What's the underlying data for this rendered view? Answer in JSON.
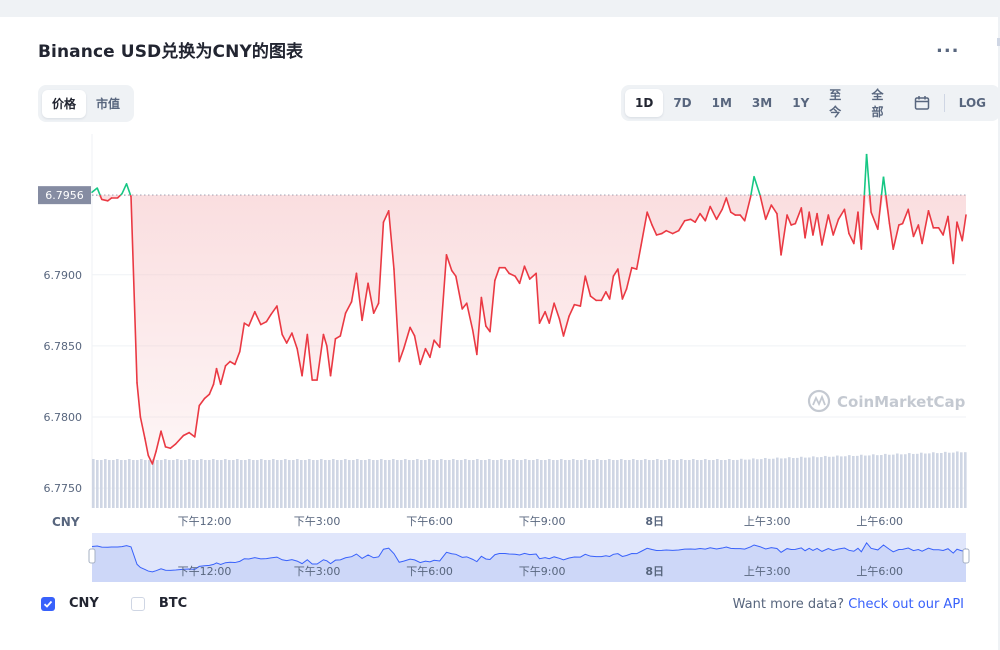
{
  "header": {
    "title": "Binance USD兑换为CNY的图表",
    "more_label": "..."
  },
  "view_toggle": {
    "items": [
      "价格",
      "市值"
    ],
    "active": 0
  },
  "range_toggle": {
    "items": [
      "1D",
      "7D",
      "1M",
      "3M",
      "1Y",
      "至今",
      "全部"
    ],
    "active": 0,
    "calendar_icon": "calendar-icon",
    "log_label": "LOG"
  },
  "watermark": {
    "text": "CoinMarketCap",
    "icon": "coinmarketcap-logo-icon"
  },
  "colors": {
    "up": "#16c784",
    "down": "#ea3943",
    "fill": "#f6c3c6",
    "volume": "#cfd6e4",
    "navigator": "#e0e6fb",
    "navigator_line": "#3861fb",
    "current_label_bg": "#858ca2"
  },
  "chart_data": {
    "type": "line",
    "currency_label": "CNY",
    "current_price_label": "6.7956",
    "baseline": 6.7956,
    "ylim": [
      6.7736,
      6.7999
    ],
    "y_ticks": [
      "6.7750",
      "6.7800",
      "6.7850",
      "6.7900"
    ],
    "x_ticks": [
      "下午12:00",
      "下午3:00",
      "下午6:00",
      "下午9:00",
      "8日",
      "上午3:00",
      "上午6:00"
    ],
    "x_tick_hours": [
      3.0,
      6.0,
      9.0,
      12.0,
      15.0,
      18.0,
      21.0
    ],
    "x_range_hours": [
      0,
      23.3
    ],
    "series": [
      {
        "x": [
          0.0,
          0.14,
          0.26,
          0.42,
          0.52,
          0.68,
          0.8,
          0.92,
          1.04,
          1.2,
          1.29,
          1.41,
          1.5,
          1.61,
          1.71,
          1.84,
          1.96,
          2.09,
          2.23,
          2.44,
          2.59,
          2.74,
          2.86,
          3.0,
          3.13,
          3.24,
          3.32,
          3.43,
          3.56,
          3.68,
          3.81,
          3.94,
          4.06,
          4.18,
          4.34,
          4.5,
          4.65,
          4.77,
          4.93,
          5.07,
          5.19,
          5.33,
          5.47,
          5.6,
          5.74,
          5.87,
          6.0,
          6.17,
          6.26,
          6.36,
          6.49,
          6.62,
          6.76,
          6.92,
          7.05,
          7.2,
          7.36,
          7.51,
          7.64,
          7.77,
          7.91,
          8.05,
          8.19,
          8.31,
          8.48,
          8.6,
          8.75,
          8.89,
          9.01,
          9.12,
          9.27,
          9.45,
          9.59,
          9.7,
          9.87,
          9.99,
          10.15,
          10.26,
          10.38,
          10.5,
          10.61,
          10.74,
          10.86,
          11.01,
          11.12,
          11.28,
          11.4,
          11.53,
          11.67,
          11.84,
          11.93,
          12.08,
          12.19,
          12.32,
          12.46,
          12.57,
          12.72,
          12.86,
          13.02,
          13.15,
          13.29,
          13.44,
          13.58,
          13.7,
          13.8,
          13.9,
          14.02,
          14.14,
          14.25,
          14.39,
          14.52,
          14.64,
          14.8,
          14.93,
          15.05,
          15.19,
          15.31,
          15.48,
          15.64,
          15.8,
          15.96,
          16.08,
          16.21,
          16.35,
          16.48,
          16.65,
          16.8,
          16.91,
          17.03,
          17.15,
          17.28,
          17.4,
          17.56,
          17.65,
          17.81,
          17.96,
          18.11,
          18.26,
          18.37,
          18.53,
          18.64,
          18.75,
          18.91,
          19.01,
          19.12,
          19.22,
          19.33,
          19.46,
          19.63,
          19.76,
          19.9,
          20.06,
          20.18,
          20.31,
          20.42,
          20.51,
          20.65,
          20.77,
          20.95,
          21.1,
          21.26,
          21.36,
          21.51,
          21.61,
          21.76,
          21.9,
          22.03,
          22.13,
          22.3,
          22.43,
          22.57,
          22.69,
          22.82,
          22.96,
          23.06,
          23.2,
          23.3
        ],
        "y": [
          6.7958,
          6.7961,
          6.7953,
          6.7952,
          6.7954,
          6.7954,
          6.7957,
          6.7964,
          6.7955,
          6.7824,
          6.78,
          6.7785,
          6.7773,
          6.7767,
          6.7776,
          6.779,
          6.7779,
          6.7778,
          6.7781,
          6.7787,
          6.7789,
          6.7786,
          6.7808,
          6.7813,
          6.7816,
          6.7823,
          6.7834,
          6.7823,
          6.7836,
          6.7839,
          6.7837,
          6.7846,
          6.7866,
          6.7864,
          6.7874,
          6.7865,
          6.7867,
          6.7872,
          6.7878,
          6.7858,
          6.7852,
          6.7859,
          6.7848,
          6.7829,
          6.7858,
          6.7826,
          6.7826,
          6.7858,
          6.785,
          6.7829,
          6.7855,
          6.7857,
          6.7873,
          6.7881,
          6.7901,
          6.7868,
          6.7894,
          6.7873,
          6.788,
          6.7937,
          6.7945,
          6.7904,
          6.7839,
          6.7848,
          6.7863,
          6.7857,
          6.7837,
          6.7848,
          6.7842,
          6.7854,
          6.7849,
          6.7914,
          6.7903,
          6.7899,
          6.7876,
          6.788,
          6.7861,
          6.7844,
          6.7884,
          6.7864,
          6.786,
          6.7896,
          6.7905,
          6.7905,
          6.7901,
          6.7899,
          6.7894,
          6.7906,
          6.7897,
          6.7901,
          6.7866,
          6.7874,
          6.7866,
          6.788,
          6.7869,
          6.7857,
          6.7871,
          6.7879,
          6.7878,
          6.7899,
          6.7885,
          6.7882,
          6.7882,
          6.7888,
          6.7883,
          6.7899,
          6.7904,
          6.7883,
          6.789,
          6.7905,
          6.7904,
          6.7921,
          6.7944,
          6.7935,
          6.7928,
          6.7929,
          6.7931,
          6.7929,
          6.7931,
          6.7938,
          6.7939,
          6.7937,
          6.7943,
          6.7938,
          6.7948,
          6.7939,
          6.7946,
          6.7954,
          6.7944,
          6.7942,
          6.7942,
          6.7938,
          6.7955,
          6.7969,
          6.7956,
          6.7939,
          6.7949,
          6.7943,
          6.7914,
          6.7942,
          6.7935,
          6.7936,
          6.7947,
          6.7926,
          6.7944,
          6.7928,
          6.7943,
          6.7921,
          6.7942,
          6.7928,
          6.7939,
          6.7946,
          6.7929,
          6.7922,
          6.7944,
          6.7918,
          6.7985,
          6.7944,
          6.7932,
          6.7969,
          6.7936,
          6.7918,
          6.7935,
          6.7936,
          6.7946,
          6.7927,
          6.7935,
          6.7922,
          6.7945,
          6.7933,
          6.7933,
          6.7928,
          6.7941,
          6.7908,
          6.7937,
          6.7924,
          6.7942
        ]
      }
    ],
    "navigator": {
      "x_ticks": [
        "下午12:00",
        "下午3:00",
        "下午6:00",
        "下午9:00",
        "8日",
        "上午3:00",
        "上午6:00"
      ]
    }
  },
  "footer": {
    "checkboxes": [
      {
        "label": "CNY",
        "checked": true
      },
      {
        "label": "BTC",
        "checked": false
      }
    ],
    "api_text": "Want more data?",
    "api_link": "Check out our API"
  }
}
